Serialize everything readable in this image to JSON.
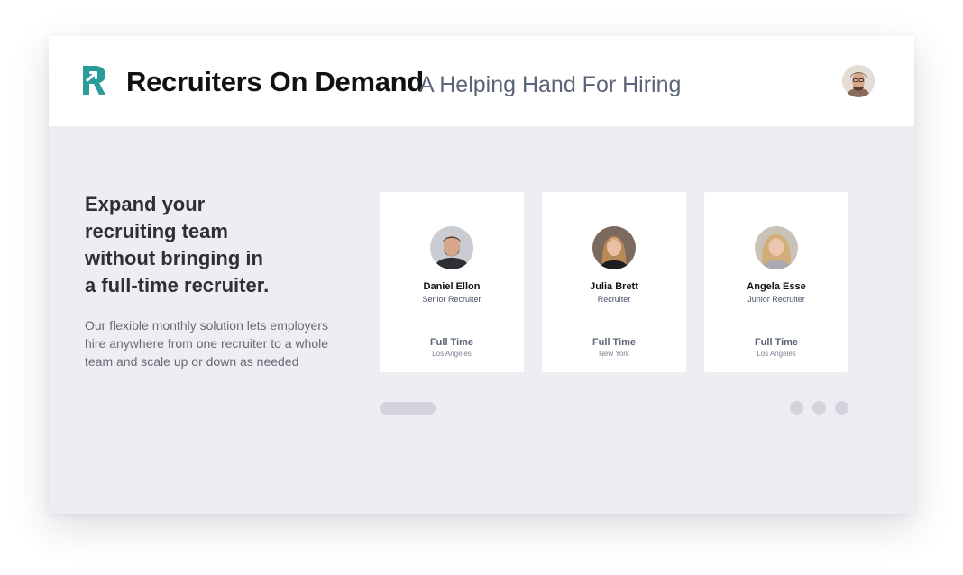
{
  "header": {
    "brand": "Recruiters On Demand",
    "tagline": "A Helping Hand For Hiring",
    "logo_icon": "r-arrow-logo-icon",
    "avatar_icon": "user-avatar-icon"
  },
  "hero": {
    "headline_lines": [
      "Expand your",
      "recruiting team",
      "without bringing in",
      "a full-time recruiter."
    ],
    "description_lines": [
      "Our flexible monthly solution lets employers",
      "hire anywhere from one recruiter to a whole",
      "team and scale up or down as needed"
    ]
  },
  "cards": [
    {
      "name": "Daniel Ellon",
      "role": "Senior Recruiter",
      "type": "Full Time",
      "location": "Los Angeles"
    },
    {
      "name": "Julia Brett",
      "role": "Recruiter",
      "type": "Full Time",
      "location": "New York"
    },
    {
      "name": "Angela Esse",
      "role": "Junior Recruiter",
      "type": "Full Time",
      "location": "Los Angeles"
    }
  ],
  "carousel": {
    "dots": 3
  },
  "colors": {
    "accent": "#2a9d9a",
    "background": "#ededf2",
    "card": "#ffffff",
    "muted": "#d3d3de"
  }
}
